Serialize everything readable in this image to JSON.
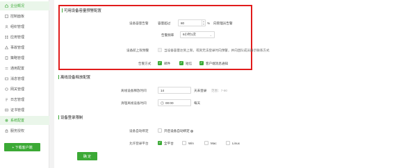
{
  "sidebar": {
    "items": [
      {
        "label": "企业概况",
        "icon": "home-icon",
        "active": true
      },
      {
        "label": "控制面板",
        "icon": "dashboard-icon"
      },
      {
        "label": "组织管理",
        "icon": "org-icon"
      },
      {
        "label": "应用管理",
        "icon": "apps-icon"
      },
      {
        "label": "事故管理",
        "icon": "incident-icon"
      },
      {
        "label": "策略管理",
        "icon": "policy-icon"
      },
      {
        "label": "通用配置",
        "icon": "config-icon"
      },
      {
        "label": "消息管理",
        "icon": "message-icon"
      },
      {
        "label": "网关管理",
        "icon": "gateway-icon"
      },
      {
        "label": "日志管理",
        "icon": "log-icon"
      },
      {
        "label": "证书管理",
        "icon": "cert-icon"
      },
      {
        "label": "系统配置",
        "icon": "gear-icon",
        "active": true
      },
      {
        "label": "服务授权",
        "icon": "auth-icon"
      }
    ],
    "download_label": "+ 下载客户端"
  },
  "storage_section": {
    "title": "可用设备容量预警配置",
    "threshold_label": "设备容量告警",
    "threshold_prefix": "容量超过",
    "threshold_value": "80",
    "threshold_suffix_pct": "%",
    "threshold_suffix": "向管理员告警",
    "freq_label": "告警频率",
    "freq_value": "6小时1次",
    "limit_label": "设备航上限预警",
    "limit_text": "当设备容量达到上限，或资无法登录时向预警，并向团队成员展示联系方式",
    "method_label": "告警方式",
    "methods": [
      "邮件",
      "短信",
      "客户端消息通知"
    ]
  },
  "offline_section": {
    "title": "离线设备释放配置",
    "max_days_label": "离线设备释放时间",
    "max_days_value": "14",
    "max_days_suffix": "天未登录",
    "max_days_hint": "范围：7-90",
    "clear_time_label": "清理离线设备时间",
    "clear_time_value": "00:00",
    "clear_time_suffix": "每天"
  },
  "login_section": {
    "title": "设备登录限制",
    "auto_bind_label": "设备自动绑定",
    "auto_bind_text": "开启设备自动绑定",
    "platform_label": "允许登录平台",
    "platforms": [
      "全平台",
      "Win",
      "Mac",
      "Linux"
    ]
  },
  "confirm_label": "确 定",
  "colors": {
    "accent": "#3ba935",
    "highlight": "#e11b1b"
  }
}
